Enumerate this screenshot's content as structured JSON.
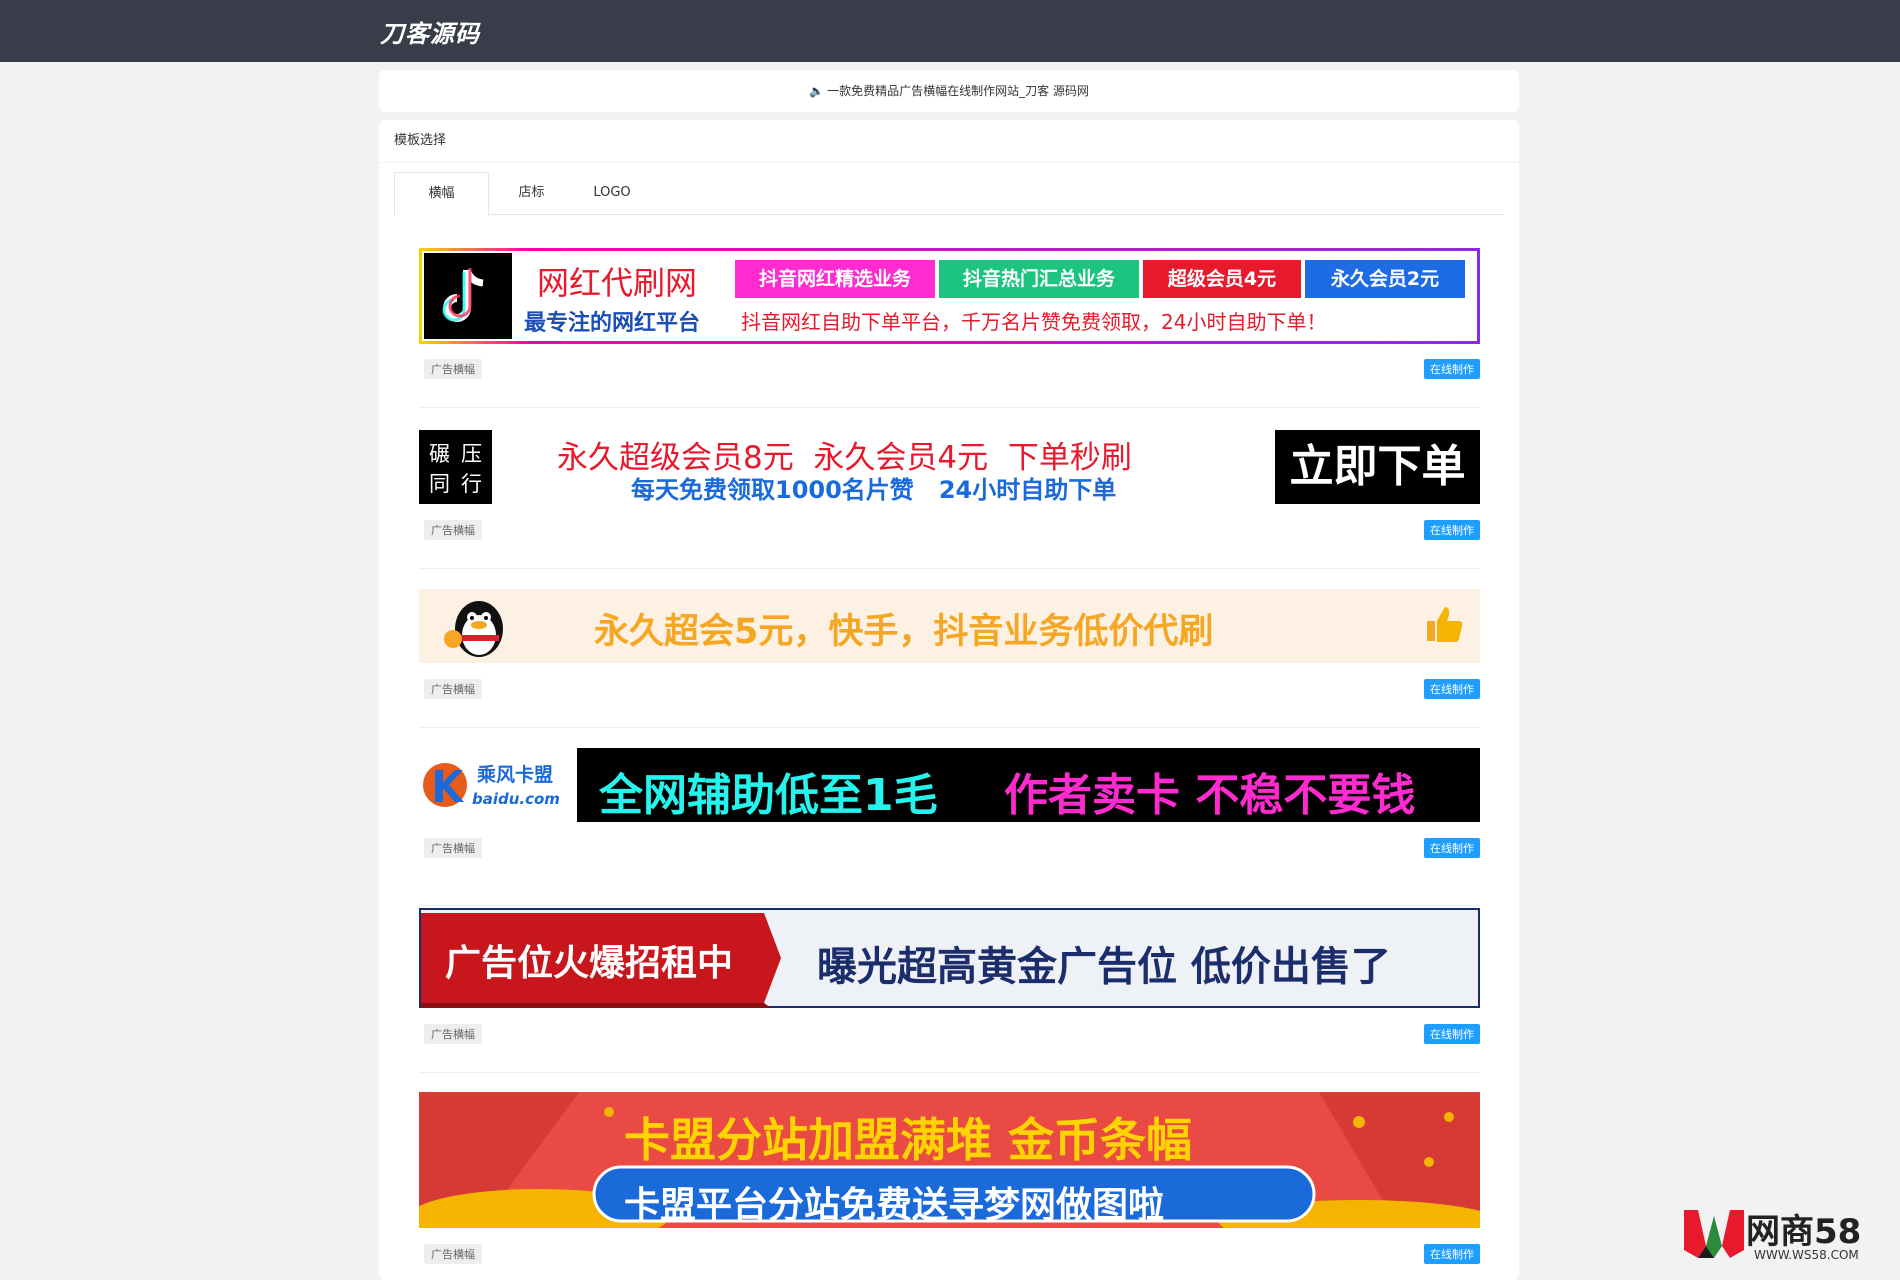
{
  "header": {
    "logo": "刀客源码"
  },
  "notice": {
    "text": "一款免费精品广告横幅在线制作网站_刀客 源码网"
  },
  "panel": {
    "title": "模板选择"
  },
  "tabs": [
    {
      "label": "横幅"
    },
    {
      "label": "店标"
    },
    {
      "label": "LOGO"
    }
  ],
  "item_tag": "广告横幅",
  "make_button": "在线制作",
  "banners": [
    {
      "title": "网红代刷网",
      "slogan": "最专注的网红平台",
      "desc": "抖音网红自助下单平台，千万名片赞免费领取，24小时自助下单！",
      "badges": [
        "抖音网红精选业务",
        "抖音热门汇总业务",
        "超级会员4元",
        "永久会员2元"
      ]
    },
    {
      "box_chars": [
        "碾",
        "压",
        "同",
        "行"
      ],
      "line1": "永久超级会员8元  永久会员4元  下单秒刷",
      "line2": "每天免费领取1000名片赞   24小时自助下单",
      "button": "立即下单"
    },
    {
      "text": "永久超会5元，快手，抖音业务低价代刷"
    },
    {
      "brand": "乘风卡盟",
      "domain": "baidu.com",
      "text1": "全网辅助低至1毛",
      "text2": "作者卖卡 不稳不要钱"
    },
    {
      "left": "广告位火爆招租中",
      "right": "曝光超高黄金广告位 低价出售了"
    },
    {
      "line1": "卡盟分站加盟满堆 金币条幅",
      "line2": "卡盟平台分站免费送寻梦网做图啦"
    }
  ],
  "watermark": {
    "name": "网商58",
    "url": "WWW.WS58.COM"
  },
  "colors": {
    "topbar": "#393d49",
    "accent": "#1e9fff"
  }
}
